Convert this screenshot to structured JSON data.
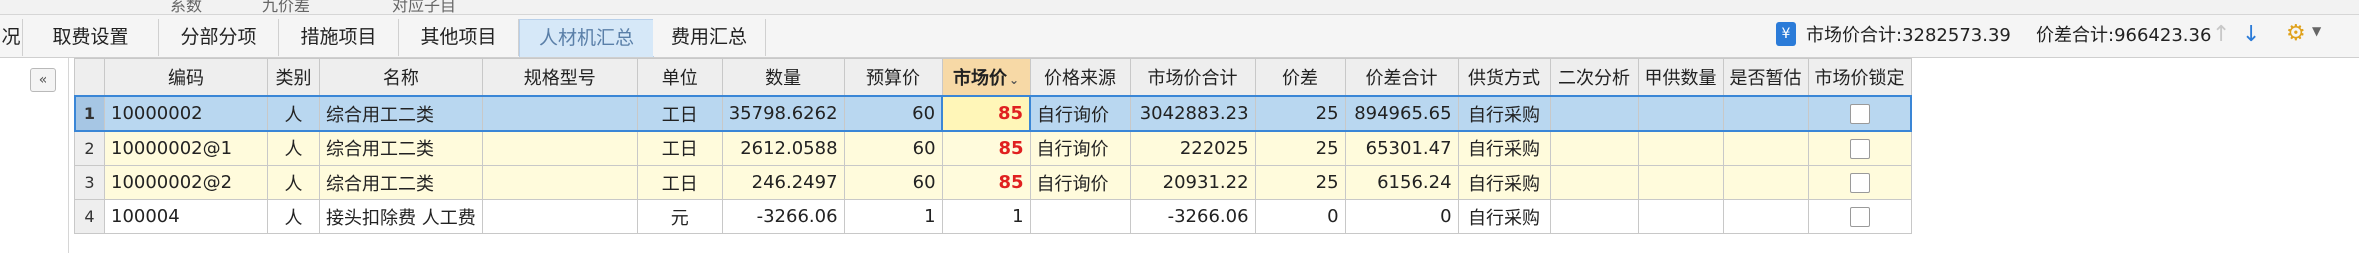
{
  "top_strip": [
    "系数",
    "九价差",
    "对应子目"
  ],
  "tabs": [
    {
      "label": "况",
      "active": false
    },
    {
      "label": "取费设置",
      "active": false
    },
    {
      "label": "分部分项",
      "active": false
    },
    {
      "label": "措施项目",
      "active": false
    },
    {
      "label": "其他项目",
      "active": false
    },
    {
      "label": "人材机汇总",
      "active": true
    },
    {
      "label": "费用汇总",
      "active": false
    }
  ],
  "summary": {
    "icon": "calculator-icon",
    "market_total_label": "市场价合计:3282573.39",
    "diff_total_label": "价差合计:966423.36"
  },
  "collapse_button": "«",
  "columns": [
    "编码",
    "类别",
    "名称",
    "规格型号",
    "单位",
    "数量",
    "预算价",
    "市场价",
    "价格来源",
    "市场价合计",
    "价差",
    "价差合计",
    "供货方式",
    "二次分析",
    "甲供数量",
    "是否暂估",
    "市场价锁定"
  ],
  "sorted_column_caret": "⌄",
  "rows": [
    {
      "no": "1",
      "code": "10000002",
      "category": "人",
      "name": "综合用工二类",
      "spec": "",
      "unit": "工日",
      "qty": "35798.6262",
      "budget_price": "60",
      "market_price": "85",
      "price_source": "自行询价",
      "market_total": "3042883.23",
      "diff": "25",
      "diff_total": "894965.65",
      "supply": "自行采购",
      "secondary": "",
      "owner_qty": "",
      "is_estimate": "",
      "locked": false
    },
    {
      "no": "2",
      "code": "10000002@1",
      "category": "人",
      "name": "综合用工二类",
      "spec": "",
      "unit": "工日",
      "qty": "2612.0588",
      "budget_price": "60",
      "market_price": "85",
      "price_source": "自行询价",
      "market_total": "222025",
      "diff": "25",
      "diff_total": "65301.47",
      "supply": "自行采购",
      "secondary": "",
      "owner_qty": "",
      "is_estimate": "",
      "locked": false
    },
    {
      "no": "3",
      "code": "10000002@2",
      "category": "人",
      "name": "综合用工二类",
      "spec": "",
      "unit": "工日",
      "qty": "246.2497",
      "budget_price": "60",
      "market_price": "85",
      "price_source": "自行询价",
      "market_total": "20931.22",
      "diff": "25",
      "diff_total": "6156.24",
      "supply": "自行采购",
      "secondary": "",
      "owner_qty": "",
      "is_estimate": "",
      "locked": false
    },
    {
      "no": "4",
      "code": "100004",
      "category": "人",
      "name": "接头扣除费 人工费",
      "spec": "",
      "unit": "元",
      "qty": "-3266.06",
      "budget_price": "1",
      "market_price": "1",
      "price_source": "",
      "market_total": "-3266.06",
      "diff": "0",
      "diff_total": "0",
      "supply": "自行采购",
      "secondary": "",
      "owner_qty": "",
      "is_estimate": "",
      "locked": false
    }
  ]
}
